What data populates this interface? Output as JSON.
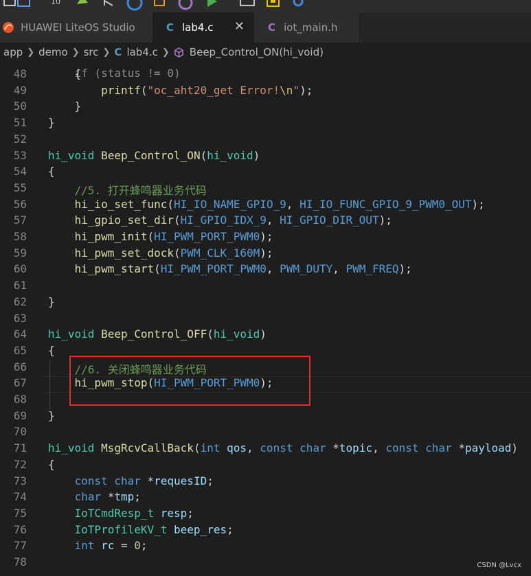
{
  "toolbar": {
    "sync_label": "10"
  },
  "tabs": [
    {
      "label": "HUAWEI LiteOS Studio",
      "icon": "liteos-logo-icon"
    },
    {
      "label": "lab4.c",
      "icon": "c-file-icon",
      "active": true
    },
    {
      "label": "iot_main.h",
      "icon": "c-header-file-icon"
    }
  ],
  "breadcrumb": {
    "parts": [
      "app",
      "demo",
      "src",
      "lab4.c",
      "Beep_Control_ON(hi_void)"
    ]
  },
  "code_lines": [
    {
      "n": "48",
      "text": "    {"
    },
    {
      "n": "49",
      "text": "        printf(\"oc_aht20_get Error!\\n\");"
    },
    {
      "n": "50",
      "text": "    }"
    },
    {
      "n": "51",
      "text": "}"
    },
    {
      "n": "52",
      "text": ""
    },
    {
      "n": "53",
      "text": "hi_void Beep_Control_ON(hi_void)"
    },
    {
      "n": "54",
      "text": "{"
    },
    {
      "n": "55",
      "text": "    //5. 打开蜂鸣器业务代码"
    },
    {
      "n": "56",
      "text": "    hi_io_set_func(HI_IO_NAME_GPIO_9, HI_IO_FUNC_GPIO_9_PWM0_OUT);"
    },
    {
      "n": "57",
      "text": "    hi_gpio_set_dir(HI_GPIO_IDX_9, HI_GPIO_DIR_OUT);"
    },
    {
      "n": "58",
      "text": "    hi_pwm_init(HI_PWM_PORT_PWM0);"
    },
    {
      "n": "59",
      "text": "    hi_pwm_set_dock(PWM_CLK_160M);"
    },
    {
      "n": "60",
      "text": "    hi_pwm_start(HI_PWM_PORT_PWM0, PWM_DUTY, PWM_FREQ);"
    },
    {
      "n": "61",
      "text": ""
    },
    {
      "n": "62",
      "text": "}"
    },
    {
      "n": "63",
      "text": ""
    },
    {
      "n": "64",
      "text": "hi_void Beep_Control_OFF(hi_void)"
    },
    {
      "n": "65",
      "text": "{"
    },
    {
      "n": "66",
      "text": "    //6. 关闭蜂鸣器业务代码"
    },
    {
      "n": "67",
      "text": "    hi_pwm_stop(HI_PWM_PORT_PWM0);"
    },
    {
      "n": "68",
      "text": ""
    },
    {
      "n": "69",
      "text": "}"
    },
    {
      "n": "70",
      "text": ""
    },
    {
      "n": "71",
      "text": "hi_void MsgRcvCallBack(int qos, const char *topic, const char *payload)"
    },
    {
      "n": "72",
      "text": "{"
    },
    {
      "n": "73",
      "text": "    const char *requesID;"
    },
    {
      "n": "74",
      "text": "    char *tmp;"
    },
    {
      "n": "75",
      "text": "    IoTCmdResp_t resp;"
    },
    {
      "n": "76",
      "text": "    IoTProfileKV_t beep_res;"
    },
    {
      "n": "77",
      "text": "    int rc = 0;"
    },
    {
      "n": "78",
      "text": ""
    }
  ],
  "watermark": "CSDN @Lvcx",
  "colors": {
    "keyword": "#569cd6",
    "type": "#4ec9b0",
    "function": "#dcdcaa",
    "string": "#ce9178",
    "comment": "#6a9955",
    "annotation_box": "#e02b2b"
  }
}
